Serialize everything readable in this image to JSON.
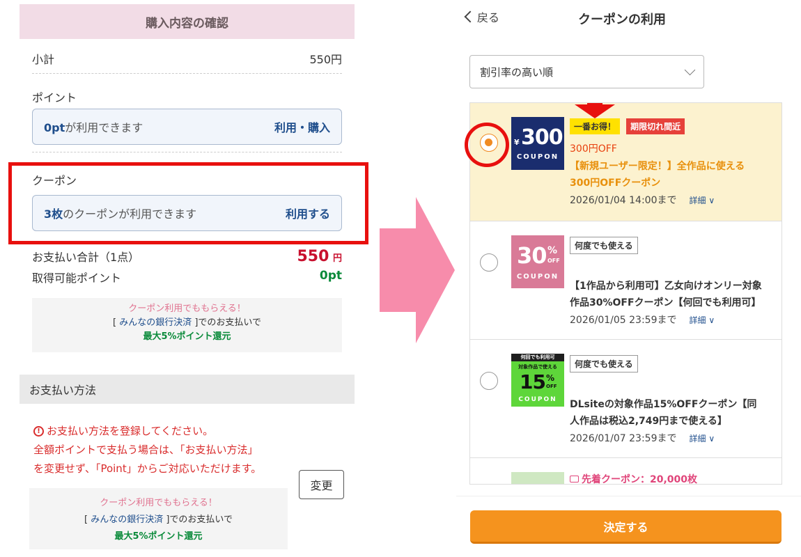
{
  "left": {
    "header": "購入内容の確認",
    "subtotal_label": "小計",
    "subtotal_value": "550円",
    "point_label": "ポイント",
    "point_box_highlight": "0pt",
    "point_box_text": "が利用できます",
    "point_box_action": "利用・購入",
    "coupon_label": "クーポン",
    "coupon_box_highlight": "3枚",
    "coupon_box_text": "のクーポンが利用できます",
    "coupon_box_action": "利用する",
    "total_label": "お支払い合計（1点）",
    "total_value": "550",
    "total_unit": "円",
    "earn_label": "取得可能ポイント",
    "earn_value": "0pt",
    "promo": {
      "line1": "クーポン利用でももらえる！",
      "line2_pre": "[ ",
      "line2_link": "みんなの銀行決済",
      "line2_post": " ]でのお支払いで",
      "line3": "最大5%ポイント還元"
    },
    "payment_header": "お支払い方法",
    "warning_icon": "!",
    "warning_lines": [
      "お支払い方法を登録してください。",
      "全額ポイントで支払う場合は、「お支払い方法」",
      "を変更せず、「Point」からご対応いただけます。"
    ],
    "change_button": "変更"
  },
  "right": {
    "back_label": "戻る",
    "title": "クーポンの利用",
    "sort_label": "割引率の高い順",
    "coupons": [
      {
        "thumb_yen": "¥",
        "thumb_big": "300",
        "thumb_sub": "COUPON",
        "tag1": "一番お得！",
        "tag2": "期限切れ間近",
        "discount": "300円OFF",
        "title_line1": "【新規ユーザー限定！】全作品に使える",
        "title_line2": "300円OFFクーポン",
        "expiry": "2026/01/04 14:00まで",
        "detail": "詳細"
      },
      {
        "thumb_big": "30",
        "thumb_pct": "%",
        "thumb_off": "OFF",
        "thumb_sub": "COUPON",
        "tag": "何度でも使える",
        "title_line1": "【1作品から利用可】乙女向けオンリー対象",
        "title_line2": "作品30%OFFクーポン【何回でも利用可】",
        "expiry": "2026/01/05 23:59まで",
        "detail": "詳細"
      },
      {
        "thumb_top": "何回でも利用可",
        "thumb_mid": "対象作品で使える",
        "thumb_big": "15",
        "thumb_pct": "%",
        "thumb_off": "OFF",
        "thumb_sub": "COUPON",
        "tag": "何度でも使える",
        "title_line1": "DLsiteの対象作品15%OFFクーポン【同",
        "title_line2": "人作品は税込2,749円まで使える】",
        "expiry": "2026/01/07 23:59まで",
        "detail": "詳細"
      },
      {
        "title_line1": "先着クーポン：20,000枚"
      }
    ],
    "decide_button": "決定する"
  },
  "colors": {
    "accent_orange": "#f5931e",
    "highlight_red": "#e8100e",
    "brand_navy": "#1a2d6e",
    "pink_arrow": "#f78cab",
    "selected_bg": "#fcf2cf"
  }
}
